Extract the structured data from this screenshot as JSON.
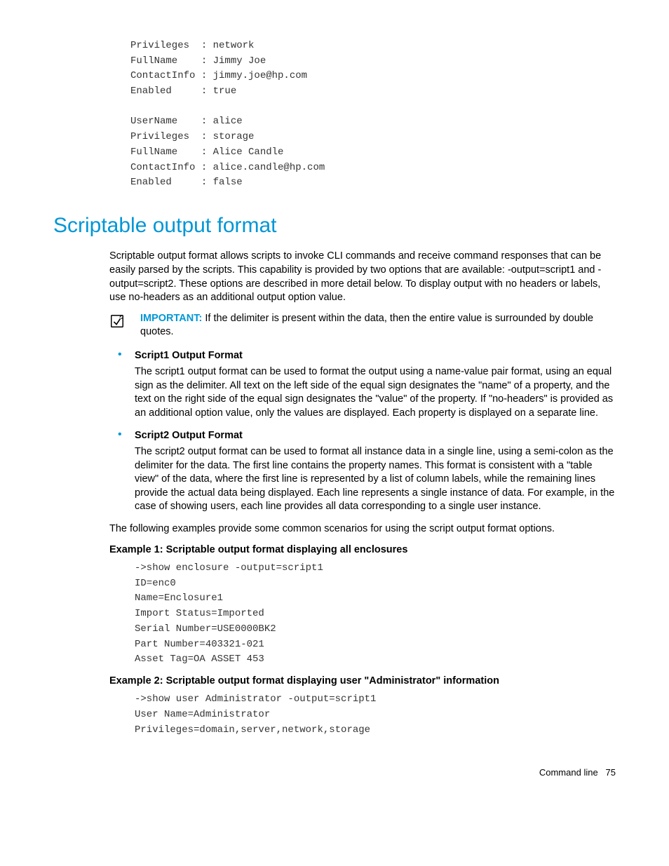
{
  "pre_block": "Privileges  : network\nFullName    : Jimmy Joe\nContactInfo : jimmy.joe@hp.com\nEnabled     : true\n\nUserName    : alice\nPrivileges  : storage\nFullName    : Alice Candle\nContactInfo : alice.candle@hp.com\nEnabled     : false",
  "heading": "Scriptable output format",
  "intro": "Scriptable output format allows scripts to invoke CLI commands and receive command responses that can be easily parsed by the scripts. This capability is provided by two options that are available: -output=script1 and -output=script2. These options are described in more detail below. To display output with no headers or labels, use no-headers as an additional output option value.",
  "important_label": "IMPORTANT:",
  "important_text": "  If the delimiter is present within the data, then the entire value is surrounded by double quotes.",
  "bullets": [
    {
      "title": "Script1 Output Format",
      "body": "The script1 output format can be used to format the output using a name-value pair format, using an equal sign as the delimiter. All text on the left side of the equal sign designates the \"name\" of a property, and the text on the right side of the equal sign designates the \"value\" of the property. If \"no-headers\" is provided as an additional option value, only the values are displayed. Each property is displayed on a separate line."
    },
    {
      "title": "Script2 Output Format",
      "body": "The script2 output format can be used to format all instance data in a single line, using a semi-colon as the delimiter for the data. The first line contains the property names. This format is consistent with a \"table view\" of the data, where the first line is represented by a list of column labels, while the remaining lines provide the actual data being displayed. Each line represents a single instance of data. For example, in the case of showing users, each line provides all data corresponding to a single user instance."
    }
  ],
  "examples_intro": "The following examples provide some common scenarios for using the script output format options.",
  "example1_title": "Example 1: Scriptable output format displaying all enclosures",
  "example1_code": "->show enclosure -output=script1\nID=enc0\nName=Enclosure1\nImport Status=Imported\nSerial Number=USE0000BK2\nPart Number=403321-021\nAsset Tag=OA ASSET 453",
  "example2_title": "Example 2: Scriptable output format displaying user \"Administrator\" information",
  "example2_code": "->show user Administrator -output=script1\nUser Name=Administrator\nPrivileges=domain,server,network,storage",
  "footer_section": "Command line",
  "footer_page": "75"
}
